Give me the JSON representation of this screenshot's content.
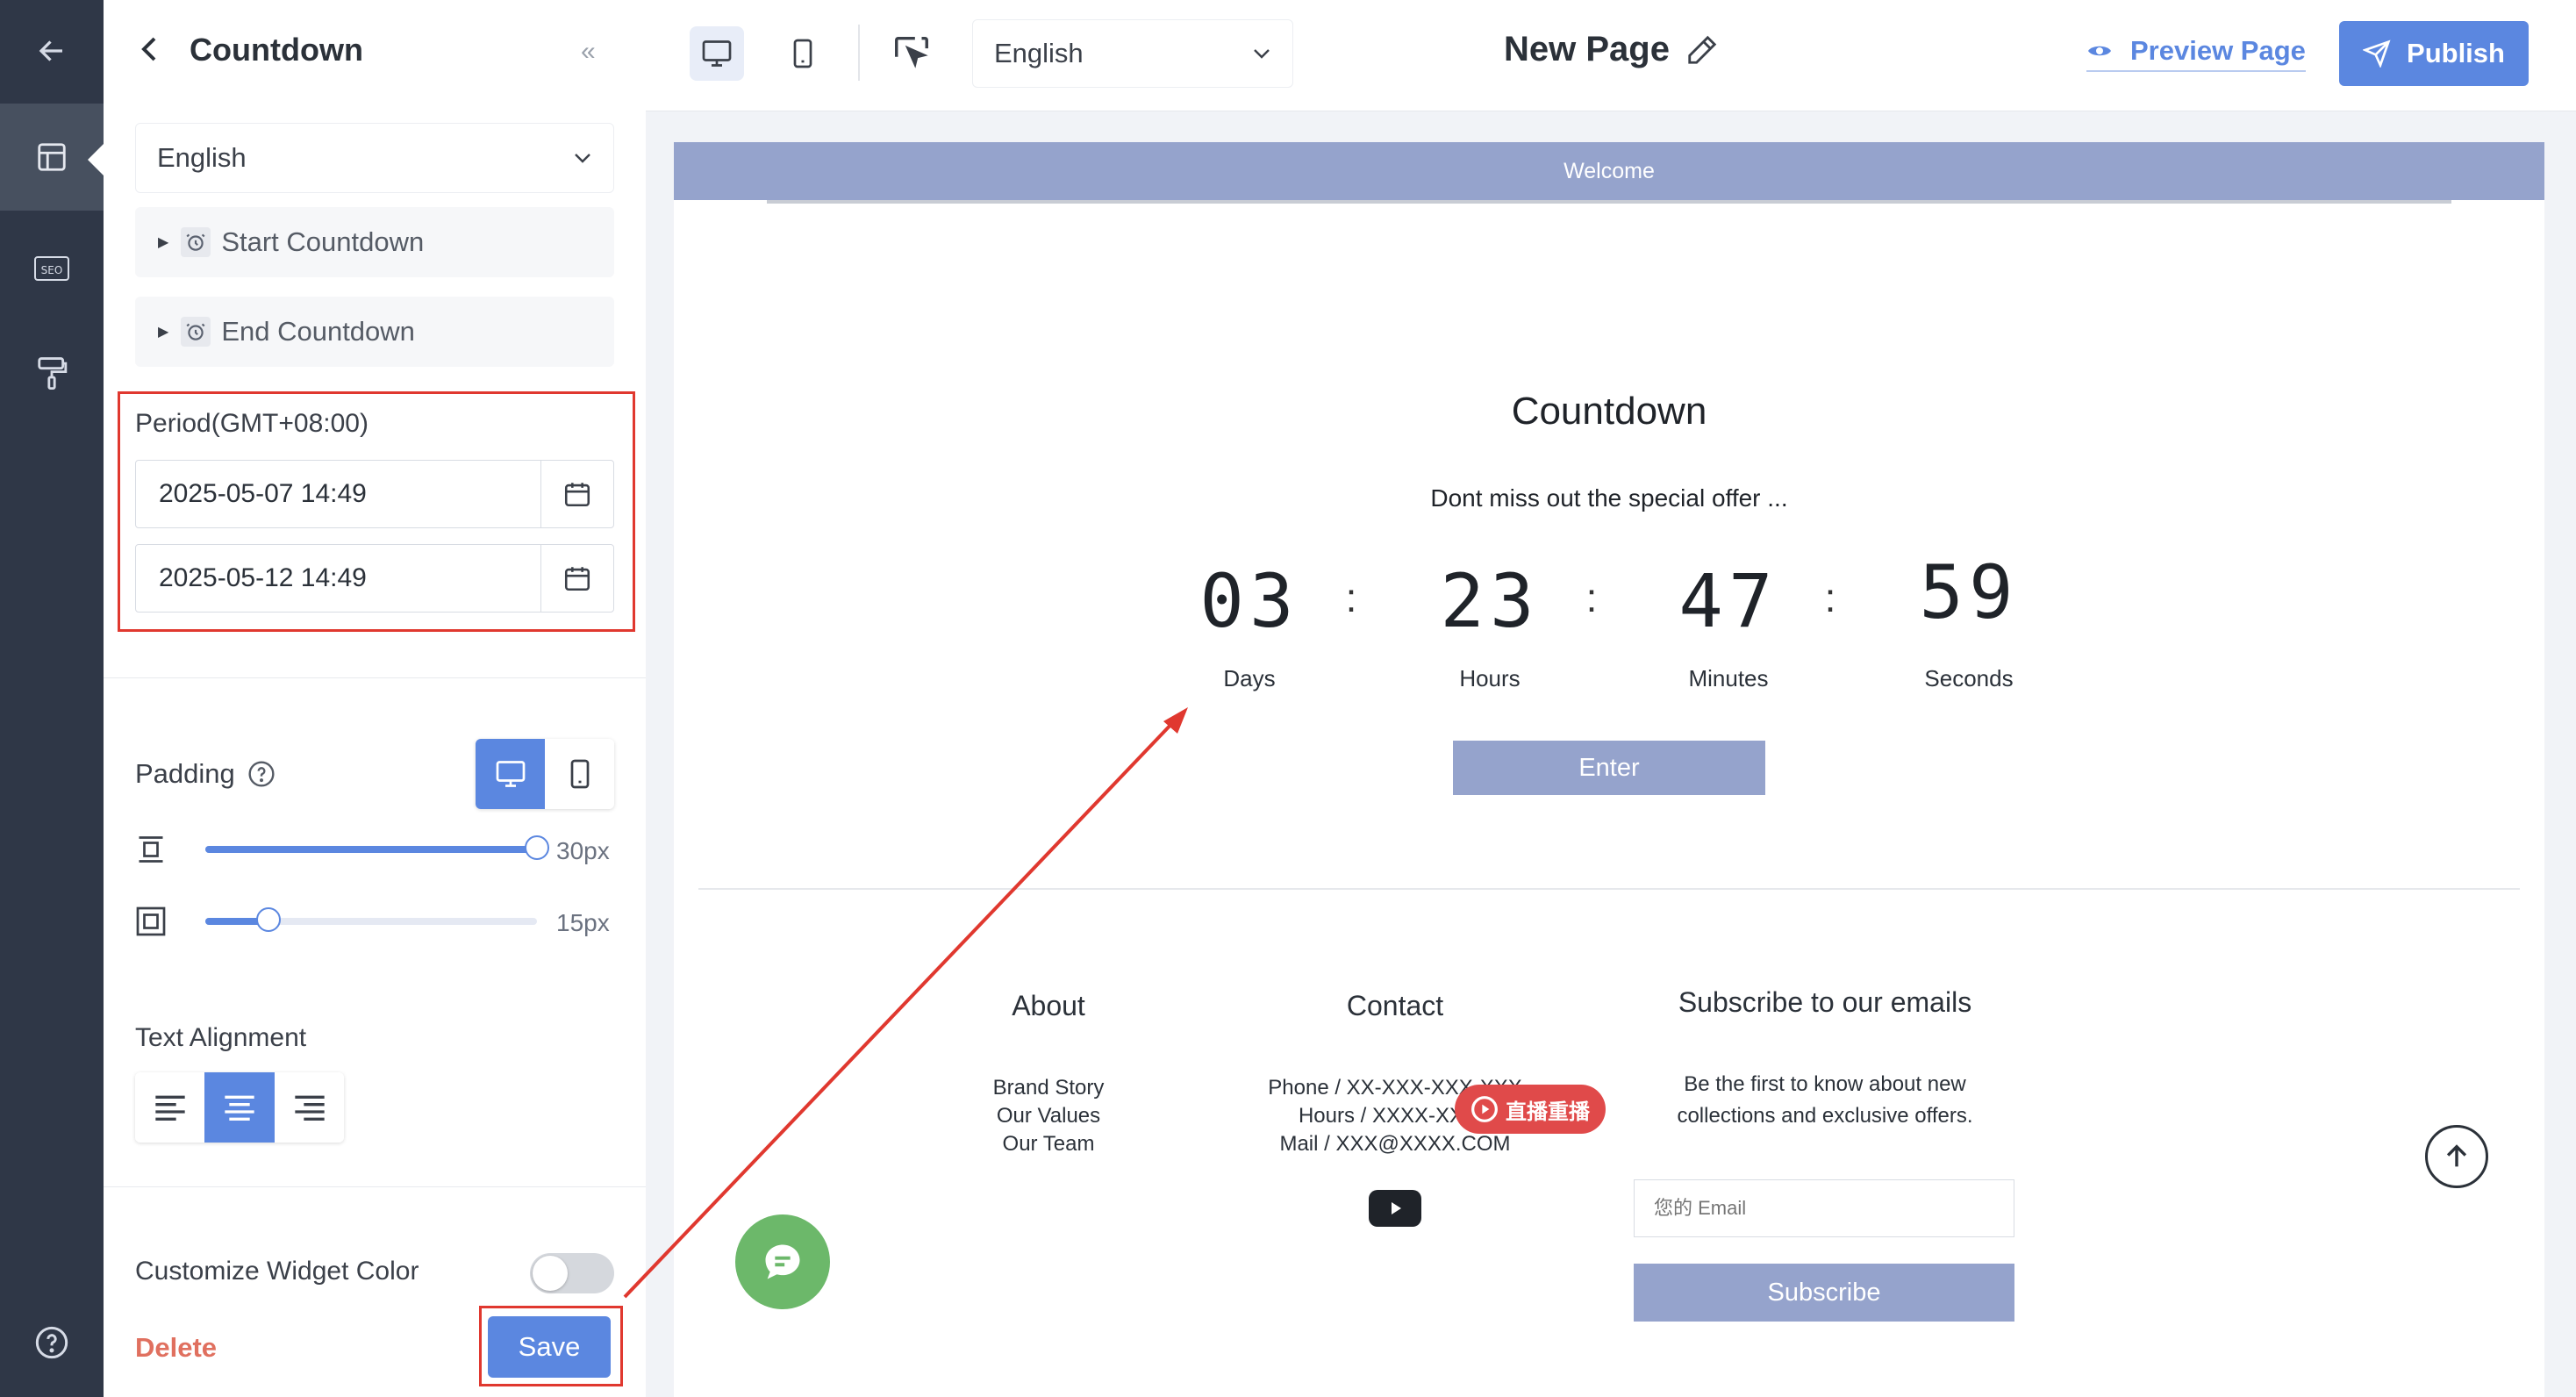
{
  "panel": {
    "title": "Countdown",
    "language": "English",
    "start_countdown": "Start Countdown",
    "end_countdown": "End Countdown",
    "period_label": "Period(GMT+08:00)",
    "start_date": "2025-05-07 14:49",
    "end_date": "2025-05-12 14:49",
    "padding_label": "Padding",
    "vertical_padding": "30px",
    "vertical_padding_fraction": 1.0,
    "horizontal_padding": "15px",
    "horizontal_padding_fraction": 0.19,
    "text_alignment_label": "Text Alignment",
    "selected_alignment": "center",
    "customize_color_label": "Customize Widget Color",
    "customize_color_on": false,
    "delete_label": "Delete",
    "save_label": "Save"
  },
  "topbar": {
    "language": "English",
    "page_title": "New Page",
    "preview_label": "Preview Page",
    "publish_label": "Publish"
  },
  "page": {
    "welcome": "Welcome",
    "countdown_title": "Countdown",
    "subtitle": "Dont miss out the special offer ...",
    "timer": [
      {
        "value": "03",
        "unit": "Days"
      },
      {
        "value": "23",
        "unit": "Hours"
      },
      {
        "value": "47",
        "unit": "Minutes"
      },
      {
        "value": "59",
        "unit": "Seconds"
      }
    ],
    "separator": ":",
    "enter_label": "Enter",
    "footer": {
      "about_title": "About",
      "about_links": [
        "Brand Story",
        "Our Values",
        "Our Team"
      ],
      "contact_title": "Contact",
      "contact_lines": [
        "Phone / XX-XXX-XXX-XXX",
        "Hours / XXXX-XXXX",
        "Mail / XXX@XXXX.COM"
      ],
      "subscribe_title": "Subscribe to our emails",
      "subscribe_text_1": "Be the first to know about new",
      "subscribe_text_2": "collections and exclusive offers.",
      "email_placeholder": "您的 Email",
      "subscribe_button": "Subscribe"
    },
    "live_replay_badge": "直播重播"
  },
  "colors": {
    "accent": "#5b87e0",
    "highlight": "#e0382f",
    "welcome_bar": "#95a3cc",
    "chat_bubble": "#6cb86a",
    "rail": "#2f3747"
  }
}
